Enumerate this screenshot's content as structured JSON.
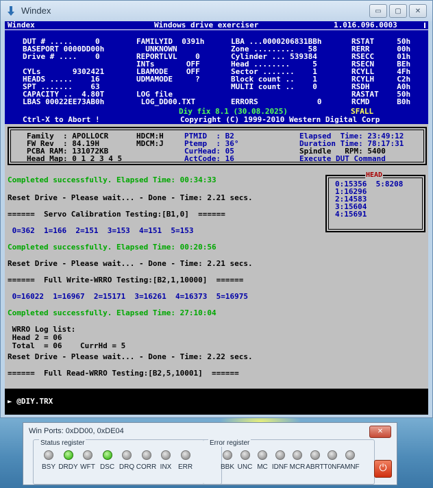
{
  "window": {
    "title": "Windex",
    "controls": {
      "minimize": "▭",
      "maximize": "▢",
      "close": "✕"
    }
  },
  "header": {
    "left_title": "Windex",
    "center_title": "Windows drive exerciser",
    "version": "1.016.096.0003",
    "col1": [
      "DUT # .....     0",
      "BASEPORT 0000DD00h",
      "Drive # ....    0",
      "",
      "CYLs       9302421",
      "HEADS .....    16",
      "SPT .......    63",
      "CAPACITY ..  4.80T",
      "LBAS 00022EE73AB0h"
    ],
    "col2": [
      "FAMILYID  0391h",
      "  UNKNOWN",
      "REPORTLVL    0",
      "INTs       OFF",
      "LBAMODE    OFF",
      "UDMAMODE     ?",
      "",
      "LOG file",
      " LOG_DD00.TXT"
    ],
    "col3": [
      "LBA ...0000206831BBh",
      "Zone .........   58",
      "Cylinder ... 539384",
      "Head ........     5",
      "Sector .......    1",
      "Block count ..    1",
      "MULTI count ..    0",
      "",
      "ERRORS             0"
    ],
    "col4": [
      "RSTAT     50h",
      "RERR      00h",
      "RSECC     01h",
      "RSECN     BEh",
      "RCYLL     4Fh",
      "RCYLH     C2h",
      "RSDH      A0h",
      "RASTAT    50h",
      "RCMD      B0h"
    ],
    "diy_fix": "Diy fix 8.1 (30.08.2025)",
    "sfall": "SFALL",
    "abort_hint": "Ctrl-X to Abort !",
    "copyright": "Copyright (C) 1999-2010 Western Digital Corp"
  },
  "info": {
    "family": "Family  : APOLLOCR",
    "fwrev": "FW Rev  : 84.19H",
    "pcba": "PCBA RAM: 131072KB",
    "headmap": "Head Map: 0 1 2 3 4 5",
    "hdcm": "HDCM:H",
    "mdcm": "MDCM:J",
    "ptmid": "PTMID  : B2",
    "ptemp": "Ptemp  : 36°",
    "curhead": "CurHead: 05",
    "actcode": "ActCode: 16",
    "elapsed": "Elapsed  Time: 23:49:12",
    "duration": "Duration Time: 78:17:31",
    "spindle": "Spindle   RPM: 5400",
    "execute": "Execute DUT Command"
  },
  "head_box": {
    "title": "HEAD",
    "lines": [
      "0:15356  5:8208",
      "1:16296",
      "2:14583",
      "3:15604",
      "4:15691"
    ]
  },
  "log": [
    {
      "style": "g",
      "text": "Completed successfully. Elapsed Time: 00:34:33"
    },
    {
      "style": "k",
      "text": "Reset Drive - Please wait... - Done - Time: 2.21 secs."
    },
    {
      "style": "k",
      "text": "======  Servo Calibration Testing:[B1,0]  ======"
    },
    {
      "style": "b",
      "text": " 0=362  1=166  2=151  3=153  4=151  5=153"
    },
    {
      "style": "g",
      "text": "Completed successfully. Elapsed Time: 00:20:56"
    },
    {
      "style": "k",
      "text": "Reset Drive - Please wait... - Done - Time: 2.21 secs."
    },
    {
      "style": "k",
      "text": "======  Full Write-WRRO Testing:[B2,1,10000]  ======"
    },
    {
      "style": "b",
      "text": " 0=16022  1=16967  2=15171  3=16261  4=16373  5=16975"
    },
    {
      "style": "g",
      "text": "Completed successfully. Elapsed Time: 27:10:04"
    },
    {
      "style": "k",
      "text": " WRRO Log list:\n Head 2 = 06\n Total  = 06    CurrHd = 5"
    },
    {
      "style": "k",
      "text": "Reset Drive - Please wait... - Done - Time: 2.22 secs."
    },
    {
      "style": "k",
      "text": "======  Full Read-WRRO Testing:[B2,5,10001]  ======"
    }
  ],
  "prompt": "► @DIY.TRX",
  "ports": {
    "title": "Win Ports: 0xDD00, 0xDE04",
    "close": "✕",
    "status_label": "Status register",
    "error_label": "Error register",
    "status_leds": [
      {
        "name": "BSY",
        "on": false
      },
      {
        "name": "DRDY",
        "on": true
      },
      {
        "name": "WFT",
        "on": false
      },
      {
        "name": "DSC",
        "on": true
      },
      {
        "name": "DRQ",
        "on": false
      },
      {
        "name": "CORR",
        "on": false
      },
      {
        "name": "INX",
        "on": false
      },
      {
        "name": "ERR",
        "on": false
      }
    ],
    "error_leds": [
      {
        "name": "BBK",
        "on": false
      },
      {
        "name": "UNC",
        "on": false
      },
      {
        "name": "MC",
        "on": false
      },
      {
        "name": "IDNF",
        "on": false
      },
      {
        "name": "MCR",
        "on": false
      },
      {
        "name": "ABRT",
        "on": false
      },
      {
        "name": "T0NF",
        "on": false
      },
      {
        "name": "AMNF",
        "on": false
      }
    ],
    "power": "⏻"
  }
}
